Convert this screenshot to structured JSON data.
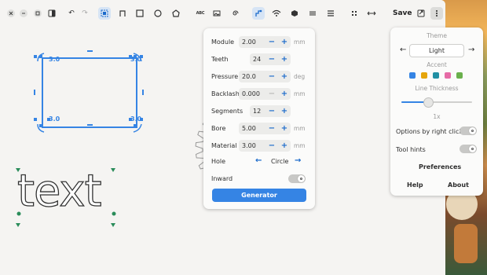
{
  "toolbar": {
    "abc_label": "ABC",
    "save_label": "Save"
  },
  "canvas": {
    "rect_corner_labels": [
      "3.0",
      "3.0",
      "3.0",
      "3.0"
    ],
    "text_object": "text"
  },
  "gear_panel": {
    "fields": [
      {
        "label": "Module",
        "value": "2.00",
        "unit": "mm"
      },
      {
        "label": "Teeth",
        "value": "24",
        "unit": ""
      },
      {
        "label": "Pressure",
        "value": "20.0",
        "unit": "deg"
      },
      {
        "label": "Backlash",
        "value": "0.000",
        "unit": "mm"
      },
      {
        "label": "Segments",
        "value": "12",
        "unit": ""
      },
      {
        "label": "Bore",
        "value": "5.00",
        "unit": "mm"
      },
      {
        "label": "Material",
        "value": "3.00",
        "unit": "mm"
      }
    ],
    "hole_label": "Hole",
    "hole_value": "Circle",
    "inward_label": "Inward",
    "generator_label": "Generator"
  },
  "menu": {
    "theme_caption": "Theme",
    "theme_value": "Light",
    "accent_caption": "Accent",
    "accent_colors": [
      "#3584e4",
      "#e5a50a",
      "#2190a4",
      "#e66ba6",
      "#6ab04c"
    ],
    "line_thickness_caption": "Line Thickness",
    "line_thickness_value": "1x",
    "options_right_click_label": "Options by right click",
    "tool_hints_label": "Tool hints",
    "preferences_label": "Preferences",
    "help_label": "Help",
    "about_label": "About"
  },
  "colors": {
    "accent": "#3584e4",
    "handles": "#2a8c5a"
  }
}
